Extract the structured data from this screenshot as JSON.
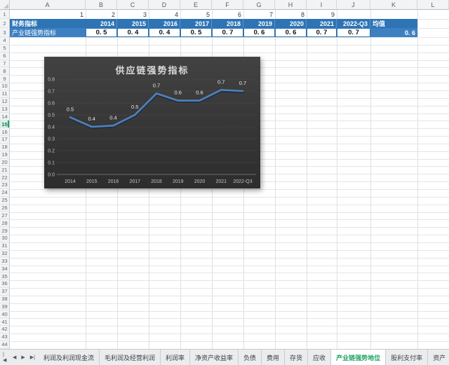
{
  "sheet": {
    "column_letters": [
      "A",
      "B",
      "C",
      "D",
      "E",
      "F",
      "G",
      "H",
      "I",
      "J",
      "K",
      "L"
    ],
    "row_count": 44,
    "selected_row": 15,
    "row1_values": [
      "1",
      "2",
      "3",
      "4",
      "5",
      "6",
      "7",
      "8",
      "9"
    ],
    "row2": {
      "label": "财务指标",
      "years": [
        "2014",
        "2015",
        "2016",
        "2017",
        "2018",
        "2019",
        "2020",
        "2021"
      ],
      "quarter": "2022-Q3",
      "mean_label": "均值"
    },
    "row3": {
      "label": "产业链强势指标",
      "values": [
        "0. 5",
        "0. 4",
        "0. 4",
        "0. 5",
        "0. 7",
        "0. 6",
        "0. 6",
        "0. 7",
        "0. 7"
      ],
      "mean": "0. 6"
    }
  },
  "chart_data": {
    "type": "line",
    "title": "供应链强势指标",
    "categories": [
      "2014",
      "2015",
      "2016",
      "2017",
      "2018",
      "2019",
      "2020",
      "2021",
      "2022-Q3"
    ],
    "values": [
      0.48,
      0.4,
      0.41,
      0.5,
      0.68,
      0.62,
      0.62,
      0.71,
      0.7
    ],
    "point_labels": [
      "0.5",
      "0.4",
      "0.4",
      "0.5",
      "0.7",
      "0.6",
      "0.6",
      "0.7",
      "0.7"
    ],
    "xlabel": "",
    "ylabel": "",
    "ylim": [
      0,
      0.8
    ],
    "ytick_labels": [
      "0.0",
      "0.1",
      "0.2",
      "0.3",
      "0.4",
      "0.5",
      "0.6",
      "0.7",
      "0.8"
    ],
    "grid": true,
    "legend_position": "none",
    "theme": "dark"
  },
  "tab_bar": {
    "nav_first": "|◀",
    "nav_prev": "◀",
    "nav_next": "▶",
    "nav_last": "▶|",
    "sheets": [
      {
        "label": "利润及利润现金流",
        "active": false
      },
      {
        "label": "毛利润及经营利润",
        "active": false
      },
      {
        "label": "利润率",
        "active": false
      },
      {
        "label": "净资产收益率",
        "active": false
      },
      {
        "label": "负债",
        "active": false
      },
      {
        "label": "费用",
        "active": false
      },
      {
        "label": "存货",
        "active": false
      },
      {
        "label": "应收",
        "active": false
      },
      {
        "label": "产业链强势地位",
        "active": true
      },
      {
        "label": "股利支付率",
        "active": false
      },
      {
        "label": "资产",
        "active": false
      }
    ]
  },
  "colors": {
    "header_blue": "#2e74b5",
    "light_blue": "#3c80c2",
    "chart_line": "#4f81bd",
    "chart_line_shadow": "#22303f",
    "chart_bg_top": "#424242",
    "chart_bg_bottom": "#2d2d2d",
    "chart_text": "#c3c3c3",
    "chart_label": "#e9e9e9",
    "active_tab_green": "#21a366"
  }
}
